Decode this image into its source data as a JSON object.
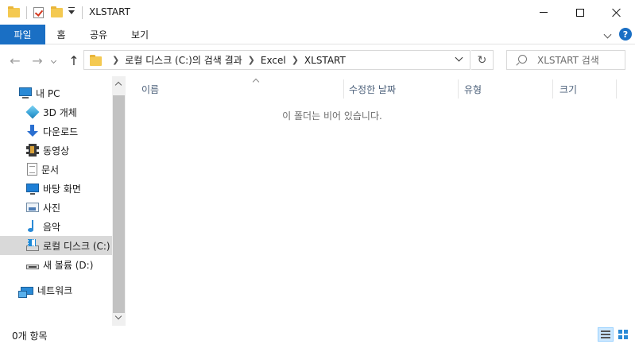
{
  "window": {
    "title": "XLSTART"
  },
  "ribbon": {
    "tabs": [
      {
        "label": "파일"
      },
      {
        "label": "홈"
      },
      {
        "label": "공유"
      },
      {
        "label": "보기"
      }
    ],
    "help_label": "?"
  },
  "address": {
    "crumbs": [
      "로컬 디스크 (C:)의 검색 결과",
      "Excel",
      "XLSTART"
    ]
  },
  "search": {
    "placeholder": "XLSTART 검색"
  },
  "sidebar": {
    "items": [
      {
        "label": "내 PC",
        "icon": "pc-icon"
      },
      {
        "label": "3D 개체",
        "icon": "3d-objects-icon"
      },
      {
        "label": "다운로드",
        "icon": "download-icon"
      },
      {
        "label": "동영상",
        "icon": "video-icon"
      },
      {
        "label": "문서",
        "icon": "document-icon"
      },
      {
        "label": "바탕 화면",
        "icon": "desktop-icon"
      },
      {
        "label": "사진",
        "icon": "pictures-icon"
      },
      {
        "label": "음악",
        "icon": "music-icon"
      },
      {
        "label": "로컬 디스크 (C:)",
        "icon": "local-disk-icon",
        "selected": true
      },
      {
        "label": "새 볼륨 (D:)",
        "icon": "drive-icon"
      },
      {
        "label": "네트워크",
        "icon": "network-icon"
      }
    ]
  },
  "content": {
    "columns": [
      "이름",
      "수정한 날짜",
      "유형",
      "크기"
    ],
    "empty_message": "이 폴더는 비어 있습니다."
  },
  "statusbar": {
    "item_count": "0개 항목"
  }
}
